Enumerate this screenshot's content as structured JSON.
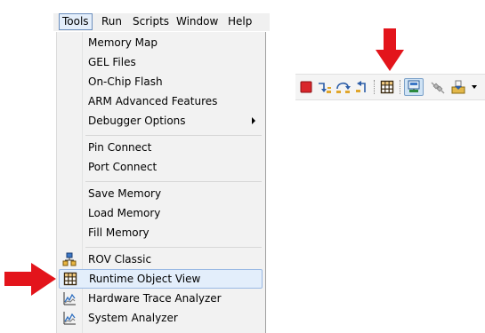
{
  "menubar": {
    "items": [
      {
        "label": "Tools",
        "active": true
      },
      {
        "label": "Run",
        "active": false
      },
      {
        "label": "Scripts",
        "active": false
      },
      {
        "label": "Window",
        "active": false
      },
      {
        "label": "Help",
        "active": false
      }
    ]
  },
  "tools_menu": {
    "groups": [
      {
        "items": [
          {
            "label": "Memory Map"
          },
          {
            "label": "GEL Files"
          },
          {
            "label": "On-Chip Flash"
          },
          {
            "label": "ARM Advanced Features"
          },
          {
            "label": "Debugger Options",
            "has_submenu": true
          }
        ]
      },
      {
        "items": [
          {
            "label": "Pin Connect"
          },
          {
            "label": "Port Connect"
          }
        ]
      },
      {
        "items": [
          {
            "label": "Save Memory"
          },
          {
            "label": "Load Memory"
          },
          {
            "label": "Fill Memory"
          }
        ]
      },
      {
        "items": [
          {
            "label": "ROV Classic",
            "icon": "rov-classic-icon"
          },
          {
            "label": "Runtime Object View",
            "icon": "grid-table-icon",
            "highlighted": true
          },
          {
            "label": "Hardware Trace Analyzer",
            "icon": "trace-chart-icon"
          },
          {
            "label": "System Analyzer",
            "icon": "trace-chart-icon"
          }
        ]
      }
    ]
  },
  "toolbar": {
    "buttons": [
      {
        "icon": "terminate-icon"
      },
      {
        "icon": "step-into-icon"
      },
      {
        "icon": "step-over-icon"
      },
      {
        "icon": "step-return-icon"
      },
      {
        "icon": "runtime-object-view-icon"
      },
      {
        "icon": "connected-target-icon",
        "pressed": true
      },
      {
        "icon": "disconnect-icon"
      },
      {
        "icon": "load-program-icon",
        "has_dropdown": true
      }
    ]
  },
  "colors": {
    "annotation_arrow": "#e3141b",
    "menu_highlight": "#e3eefb",
    "menu_highlight_border": "#9ab9e4",
    "menubar_background": "#f0f0f0",
    "menu_background": "#f2f2f2"
  }
}
